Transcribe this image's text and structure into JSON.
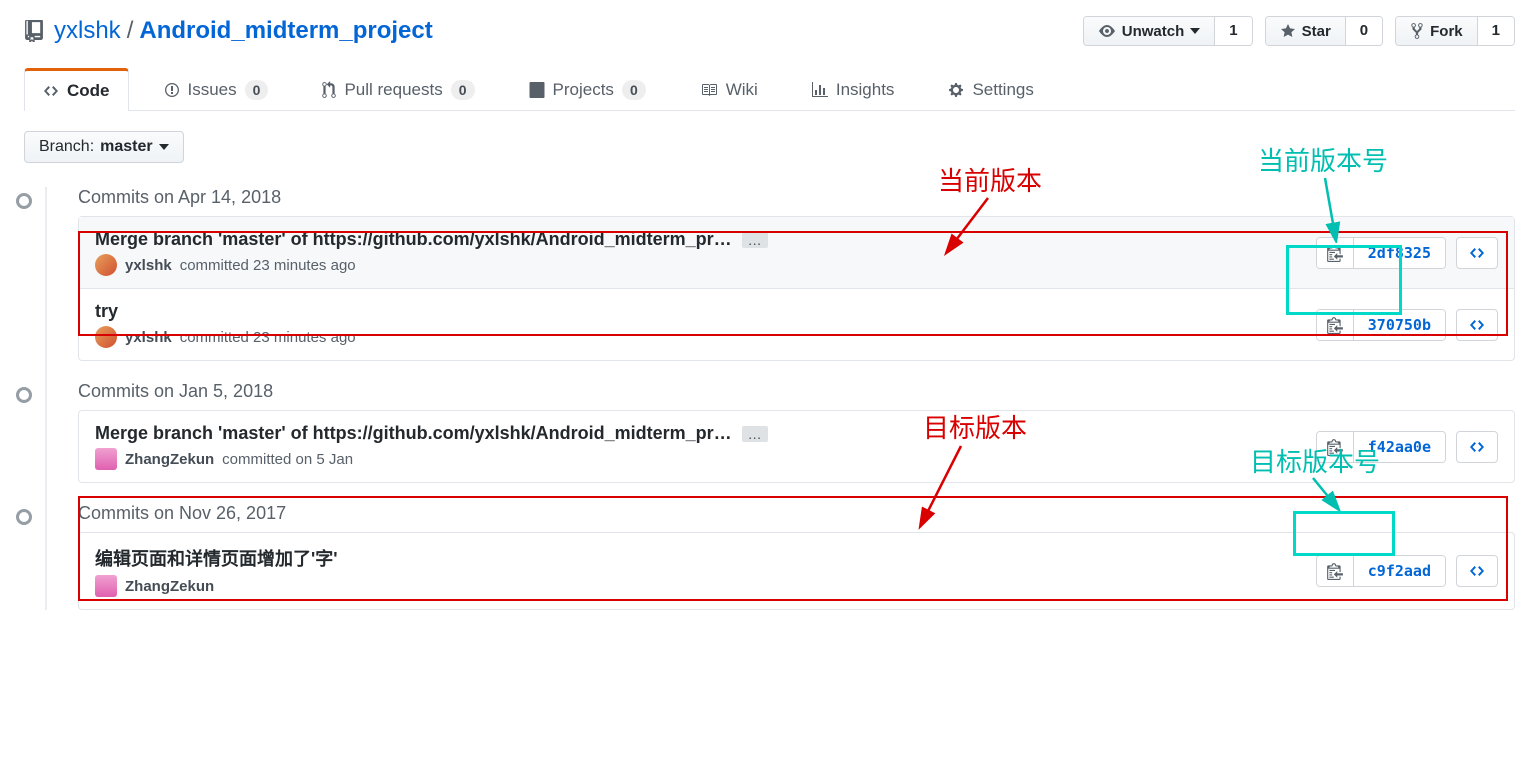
{
  "repo": {
    "owner": "yxlshk",
    "name": "Android_midterm_project"
  },
  "actions": {
    "unwatch": {
      "label": "Unwatch",
      "count": "1"
    },
    "star": {
      "label": "Star",
      "count": "0"
    },
    "fork": {
      "label": "Fork",
      "count": "1"
    }
  },
  "tabs": {
    "code": "Code",
    "issues": {
      "label": "Issues",
      "count": "0"
    },
    "pulls": {
      "label": "Pull requests",
      "count": "0"
    },
    "projects": {
      "label": "Projects",
      "count": "0"
    },
    "wiki": "Wiki",
    "insights": "Insights",
    "settings": "Settings"
  },
  "branch": {
    "prefix": "Branch:",
    "name": "master"
  },
  "groups": [
    {
      "date": "Commits on Apr 14, 2018",
      "commits": [
        {
          "title": "Merge branch 'master' of https://github.com/yxlshk/Android_midterm_pr…",
          "author": "yxlshk",
          "time": "committed 23 minutes ago",
          "sha": "2df8325",
          "avatar": "yx",
          "ellipsis": true,
          "highlight": true
        },
        {
          "title": "try",
          "author": "yxlshk",
          "time": "committed 23 minutes ago",
          "sha": "370750b",
          "avatar": "yx",
          "ellipsis": false,
          "highlight": false
        }
      ]
    },
    {
      "date": "Commits on Jan 5, 2018",
      "commits": [
        {
          "title": "Merge branch 'master' of https://github.com/yxlshk/Android_midterm_pr…",
          "author": "ZhangZekun",
          "time": "committed on 5 Jan",
          "sha": "f42aa0e",
          "avatar": "zk",
          "ellipsis": true,
          "highlight": false
        }
      ]
    },
    {
      "date": "Commits on Nov 26, 2017",
      "commits": [
        {
          "title": "编辑页面和详情页面增加了'字'",
          "author": "ZhangZekun",
          "time": "",
          "sha": "c9f2aad",
          "avatar": "zk",
          "ellipsis": false,
          "highlight": false
        }
      ]
    }
  ],
  "annotations": {
    "current_version": "当前版本",
    "current_version_num": "当前版本号",
    "target_version": "目标版本",
    "target_version_num": "目标版本号"
  }
}
